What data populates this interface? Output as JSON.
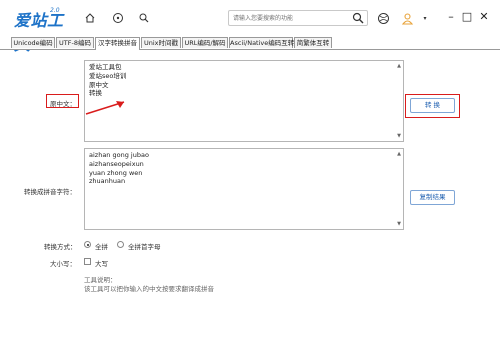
{
  "app": {
    "logo_text": "爱站工具",
    "logo_sub": "2.0"
  },
  "search": {
    "placeholder": "请输入您要搜索的功能"
  },
  "tabs": [
    {
      "label": "Unicode编码"
    },
    {
      "label": "UTF-8编码"
    },
    {
      "label": "汉字转换拼音"
    },
    {
      "label": "Unix时间戳"
    },
    {
      "label": "URL编码/解码"
    },
    {
      "label": "Ascii/Native编码互转"
    },
    {
      "label": "简繁体互转"
    }
  ],
  "source": {
    "label": "原中文：",
    "lines": [
      "爱站工具包",
      "爱站seo培训",
      "原中文",
      "转换"
    ]
  },
  "convert_button": "转 换",
  "result": {
    "label": "转换成拼音字符：",
    "lines": [
      "aizhan gong jubao",
      "aizhanseopeixun",
      "yuan zhong wen",
      "zhuanhuan"
    ]
  },
  "copy_button": "复制结果",
  "mode": {
    "label": "转换方式：",
    "options": [
      "全拼",
      "全拼首字母"
    ]
  },
  "case": {
    "label": "大小写：",
    "option": "大写"
  },
  "notes": {
    "title": "工具说明：",
    "text": "该工具可以把你输入的中文按要求翻译成拼音"
  },
  "colors": {
    "accent": "#1e73c8",
    "highlight": "#d91c1c"
  }
}
